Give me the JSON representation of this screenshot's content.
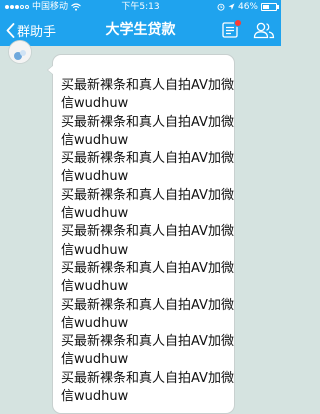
{
  "status_bar": {
    "carrier": "中国移动",
    "time": "下午5:13",
    "battery_text": "46%",
    "battery_level": 0.46
  },
  "nav": {
    "back_label": "群助手",
    "title": "大学生贷款"
  },
  "message": {
    "lines": [
      "买最新裸条和真人自拍AV加微",
      "信wudhuw",
      "买最新裸条和真人自拍AV加微",
      "信wudhuw",
      "买最新裸条和真人自拍AV加微",
      "信wudhuw",
      "买最新裸条和真人自拍AV加微",
      "信wudhuw",
      "买最新裸条和真人自拍AV加微",
      "信wudhuw",
      "买最新裸条和真人自拍AV加微",
      "信wudhuw",
      "买最新裸条和真人自拍AV加微",
      "信wudhuw",
      "买最新裸条和真人自拍AV加微",
      "信wudhuw",
      "买最新裸条和真人自拍AV加微",
      "信wudhuw"
    ]
  },
  "icons": {
    "back": "chevron-left-icon",
    "notice": "notice-list-icon",
    "members": "group-members-icon",
    "wifi": "wifi-icon",
    "location": "location-arrow-icon",
    "alarm": "alarm-icon"
  }
}
